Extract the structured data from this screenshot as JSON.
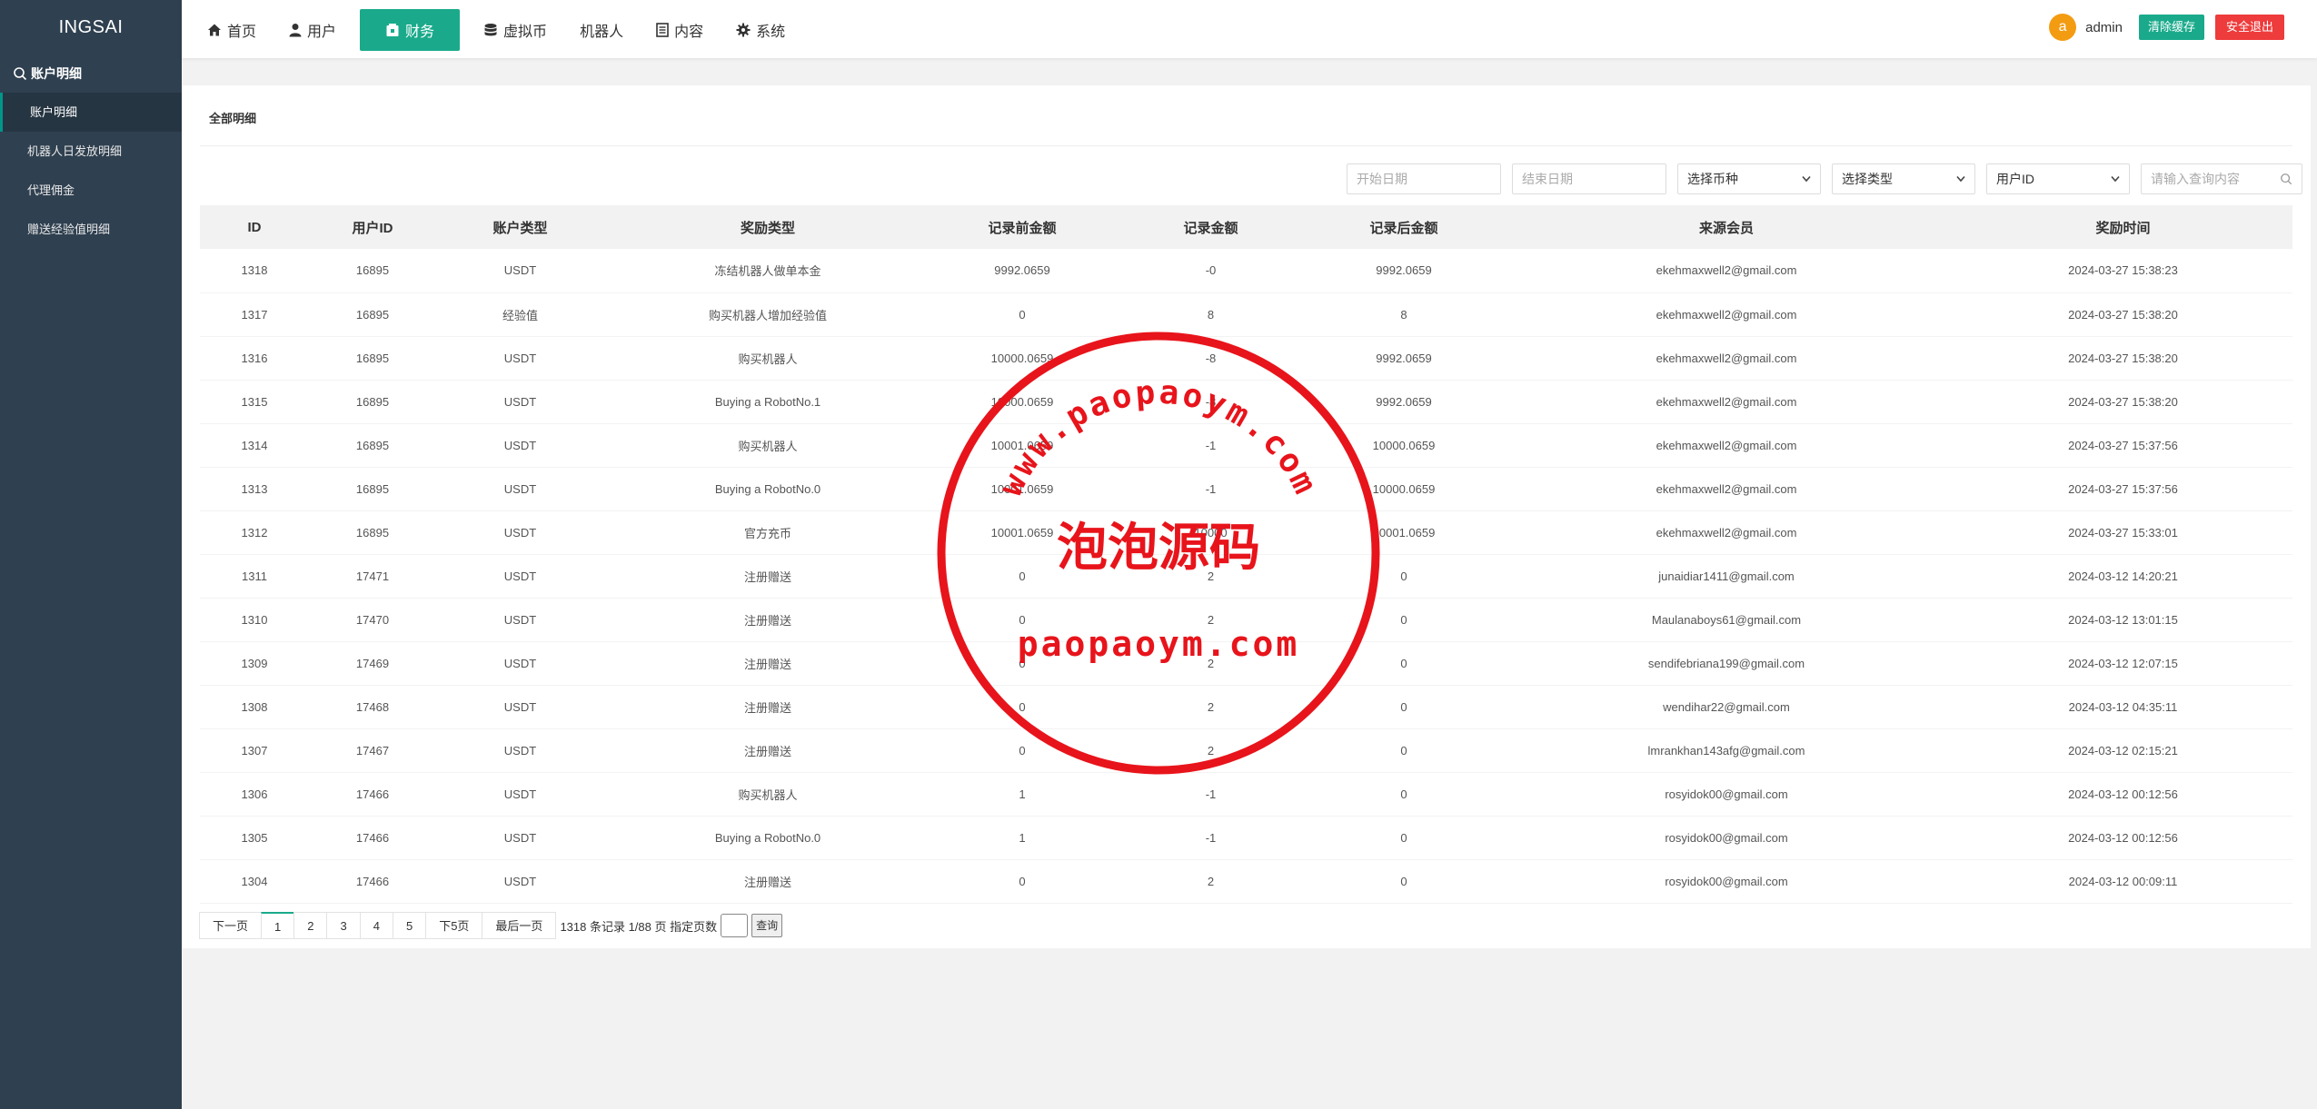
{
  "brand": "INGSAI",
  "sidebar": {
    "section": "账户明细",
    "items": [
      {
        "label": "账户明细",
        "active": true
      },
      {
        "label": "机器人日发放明细",
        "active": false
      },
      {
        "label": "代理佣金",
        "active": false
      },
      {
        "label": "赠送经验值明细",
        "active": false
      }
    ]
  },
  "nav": [
    {
      "label": "首页",
      "icon": "home-icon"
    },
    {
      "label": "用户",
      "icon": "user-icon"
    },
    {
      "label": "财务",
      "icon": "wallet-icon",
      "active": true
    },
    {
      "label": "虚拟币",
      "icon": "database-icon"
    },
    {
      "label": "机器人",
      "icon": ""
    },
    {
      "label": "内容",
      "icon": "document-icon"
    },
    {
      "label": "系统",
      "icon": "gear-icon"
    }
  ],
  "user": {
    "avatar_letter": "a",
    "name": "admin",
    "clear_cache": "清除缓存",
    "logout": "安全退出"
  },
  "panel": {
    "title": "全部明细"
  },
  "filters": {
    "start_date": "开始日期",
    "end_date": "结束日期",
    "currency": "选择币种",
    "type": "选择类型",
    "user_field": "用户ID",
    "search_placeholder": "请输入查询内容"
  },
  "table": {
    "headers": [
      "ID",
      "用户ID",
      "账户类型",
      "奖励类型",
      "记录前金额",
      "记录金额",
      "记录后金额",
      "来源会员",
      "奖励时间"
    ],
    "rows": [
      [
        "1318",
        "16895",
        "USDT",
        "冻结机器人做单本金",
        "9992.0659",
        "-0",
        "9992.0659",
        "ekehmaxwell2@gmail.com",
        "2024-03-27 15:38:23"
      ],
      [
        "1317",
        "16895",
        "经验值",
        "购买机器人增加经验值",
        "0",
        "8",
        "8",
        "ekehmaxwell2@gmail.com",
        "2024-03-27 15:38:20"
      ],
      [
        "1316",
        "16895",
        "USDT",
        "购买机器人",
        "10000.0659",
        "-8",
        "9992.0659",
        "ekehmaxwell2@gmail.com",
        "2024-03-27 15:38:20"
      ],
      [
        "1315",
        "16895",
        "USDT",
        "Buying a RobotNo.1",
        "10000.0659",
        "-8",
        "9992.0659",
        "ekehmaxwell2@gmail.com",
        "2024-03-27 15:38:20"
      ],
      [
        "1314",
        "16895",
        "USDT",
        "购买机器人",
        "10001.0659",
        "-1",
        "10000.0659",
        "ekehmaxwell2@gmail.com",
        "2024-03-27 15:37:56"
      ],
      [
        "1313",
        "16895",
        "USDT",
        "Buying a RobotNo.0",
        "10001.0659",
        "-1",
        "10000.0659",
        "ekehmaxwell2@gmail.com",
        "2024-03-27 15:37:56"
      ],
      [
        "1312",
        "16895",
        "USDT",
        "官方充币",
        "10001.0659",
        "10000",
        "20001.0659",
        "ekehmaxwell2@gmail.com",
        "2024-03-27 15:33:01"
      ],
      [
        "1311",
        "17471",
        "USDT",
        "注册赠送",
        "0",
        "2",
        "0",
        "junaidiar1411@gmail.com",
        "2024-03-12 14:20:21"
      ],
      [
        "1310",
        "17470",
        "USDT",
        "注册赠送",
        "0",
        "2",
        "0",
        "Maulanaboys61@gmail.com",
        "2024-03-12 13:01:15"
      ],
      [
        "1309",
        "17469",
        "USDT",
        "注册赠送",
        "0",
        "2",
        "0",
        "sendifebriana199@gmail.com",
        "2024-03-12 12:07:15"
      ],
      [
        "1308",
        "17468",
        "USDT",
        "注册赠送",
        "0",
        "2",
        "0",
        "wendihar22@gmail.com",
        "2024-03-12 04:35:11"
      ],
      [
        "1307",
        "17467",
        "USDT",
        "注册赠送",
        "0",
        "2",
        "0",
        "lmrankhan143afg@gmail.com",
        "2024-03-12 02:15:21"
      ],
      [
        "1306",
        "17466",
        "USDT",
        "购买机器人",
        "1",
        "-1",
        "0",
        "rosyidok00@gmail.com",
        "2024-03-12 00:12:56"
      ],
      [
        "1305",
        "17466",
        "USDT",
        "Buying a RobotNo.0",
        "1",
        "-1",
        "0",
        "rosyidok00@gmail.com",
        "2024-03-12 00:12:56"
      ],
      [
        "1304",
        "17466",
        "USDT",
        "注册赠送",
        "0",
        "2",
        "0",
        "rosyidok00@gmail.com",
        "2024-03-12 00:09:11"
      ]
    ]
  },
  "pagination": {
    "prev": "下一页",
    "pages": [
      "1",
      "2",
      "3",
      "4",
      "5"
    ],
    "current": "1",
    "next5": "下5页",
    "last": "最后一页",
    "info": "1318 条记录 1/88 页 指定页数",
    "go": "查询"
  },
  "watermark": {
    "arc_text": "www.paopaoym.com",
    "center_text": "泡泡源码",
    "bottom_text": "paopaoym.com",
    "color": "#e8141b"
  },
  "colors": {
    "sidebar": "#2f4050",
    "accent": "#1aaa8b",
    "danger": "#ee3b3b",
    "avatar": "#f39c12"
  }
}
